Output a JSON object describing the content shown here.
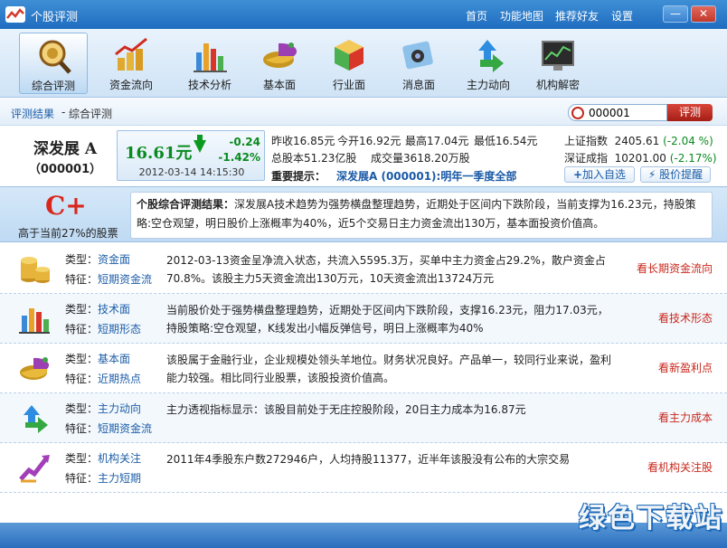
{
  "window": {
    "title": "个股评测",
    "nav": [
      "首页",
      "功能地图",
      "推荐好友",
      "设置"
    ],
    "min_label": "—",
    "close_label": "✕"
  },
  "toolbar": {
    "items": [
      {
        "label": "综合评测",
        "icon": "magnifier-icon",
        "active": true
      },
      {
        "label": "资金流向",
        "icon": "coins-chart-icon"
      },
      {
        "label": "技术分析",
        "icon": "bar-chart-icon"
      },
      {
        "label": "基本面",
        "icon": "pie-chart-icon"
      },
      {
        "label": "行业面",
        "icon": "cube-icon"
      },
      {
        "label": "消息面",
        "icon": "news-icon"
      },
      {
        "label": "主力动向",
        "icon": "arrows-icon"
      },
      {
        "label": "机构解密",
        "icon": "monitor-icon"
      }
    ]
  },
  "breadcrumb": {
    "root": "评测结果",
    "sep": "-",
    "current": "综合评测"
  },
  "search": {
    "value": "000001",
    "button": "评测"
  },
  "stock": {
    "name": "深发展 A",
    "code": "（000001）",
    "price": "16.61元",
    "change": "-0.24",
    "change_pct": "-1.42%",
    "time": "2012-03-14 14:15:30",
    "prev_close_label": "昨收",
    "prev_close": "16.85元",
    "open_label": "今开",
    "open": "16.92元",
    "high_label": "最高",
    "high": "17.04元",
    "low_label": "最低",
    "low": "16.54元",
    "total_shares_label": "总股本",
    "total_shares": "51.23亿股",
    "volume_label": "成交量",
    "volume": "3618.20万股",
    "tip_label": "重要提示：",
    "tip": "深发展A (000001):明年一季度全部"
  },
  "indices": {
    "sh_label": "上证指数",
    "sh_value": "2405.61",
    "sh_change": "-2.04 %",
    "sz_label": "深证成指",
    "sz_value": "10201.00",
    "sz_change": "-2.17%",
    "watch_button": "加入自选",
    "alert_button": "股价提醒"
  },
  "summary": {
    "grade": "C+",
    "sub": "高于当前27%的股票",
    "title": "个股综合评测结果：",
    "text": "深发展A技术趋势为强势横盘整理趋势，近期处于区间内下跌阶段，当前支撑为16.23元，持股策略:空仓观望，明日股价上涨概率为40%，近5个交易日主力资金流出130万，基本面投资价值高。"
  },
  "details": [
    {
      "type_label": "类型：",
      "type": "资金面",
      "feat_label": "特征：",
      "feat": "短期资金流",
      "text": "2012-03-13资金呈净流入状态，共流入5595.3万，买单中主力资金占29.2%，散户资金占70.8%。该股主力5天资金流出130万元，10天资金流出13724万元",
      "link": "看长期资金流向",
      "icon": "coins-icon"
    },
    {
      "type_label": "类型：",
      "type": "技术面",
      "feat_label": "特征：",
      "feat": "短期形态",
      "text": "当前股价处于强势横盘整理趋势，近期处于区间内下跌阶段，支撑16.23元，阻力17.03元，持股策略:空仓观望，K线发出小幅反弹信号，明日上涨概率为40%",
      "link": "看技术形态",
      "icon": "bar-chart-icon"
    },
    {
      "type_label": "类型：",
      "type": "基本面",
      "feat_label": "特征：",
      "feat": "近期热点",
      "text": "该股属于金融行业，企业规模处领头羊地位。财务状况良好。产品单一，较同行业来说，盈利能力较强。相比同行业股票，该股投资价值高。",
      "link": "看新盈利点",
      "icon": "pie-chart-icon"
    },
    {
      "type_label": "类型：",
      "type": "主力动向",
      "feat_label": "特征：",
      "feat": "短期资金流",
      "text": "主力透视指标显示：该股目前处于无庄控股阶段，20日主力成本为16.87元",
      "link": "看主力成本",
      "icon": "arrows-icon"
    },
    {
      "type_label": "类型：",
      "type": "机构关注",
      "feat_label": "特征：",
      "feat": "主力短期",
      "text": "2011年4季股东户数272946户，人均持股11377，近半年该股没有公布的大宗交易",
      "link": "看机构关注股",
      "icon": "trend-icon"
    }
  ],
  "watermark": "绿色下载站"
}
